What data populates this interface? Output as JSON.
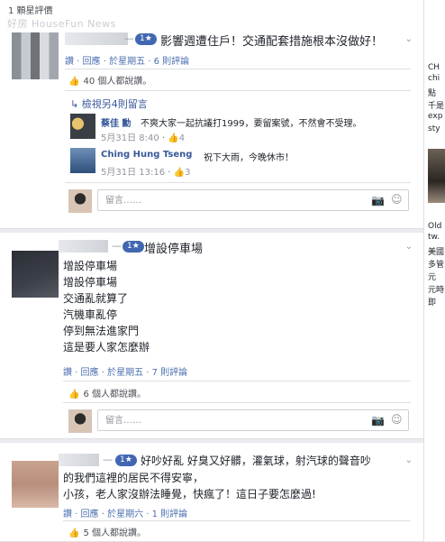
{
  "rating_label": "1 顆星評價",
  "watermark": "好房 HouseFun News",
  "comments": [
    {
      "title": "影響週遭住戶！交通配套措施根本沒做好！",
      "dash": "—",
      "badge": "1★",
      "meta": {
        "like": "讚",
        "reply": "回應",
        "date": "於星期五",
        "edit": "6 則評論"
      },
      "likes": "40 個人都說讚。",
      "more_replies": "檢視另4則留言",
      "replies": [
        {
          "name": "蔡佳 勳",
          "text": "不爽大家一起抗議打1999，要留案號，不然會不受理。",
          "date": "5月31日 8:40",
          "likes": "4"
        },
        {
          "name": "Ching Hung Tseng",
          "text": "祝下大雨，今晚休市！",
          "date": "5月31日 13:16",
          "likes": "3"
        }
      ],
      "input_placeholder": "留言……"
    },
    {
      "title": "增設停車場",
      "dash": "—",
      "badge": "1★",
      "body": [
        "增設停車場",
        "增設停車場",
        "交通亂就算了",
        "汽機車亂停",
        "停到無法進家門",
        "這是要人家怎麼辦"
      ],
      "meta": {
        "like": "讚",
        "reply": "回應",
        "date": "於星期五",
        "edit": "7 則評論"
      },
      "likes": "6 個人都說讚。",
      "input_placeholder": "留言……"
    },
    {
      "title": "好吵好亂 好臭又好髒，灌氣球，射汽球的聲音吵",
      "dash": "—",
      "badge": "1★",
      "body": [
        "的我們這裡的居民不得安寧，",
        "小孩，老人家沒辦法睡覺，快瘋了！這日子要怎麼過!"
      ],
      "meta": {
        "like": "讚",
        "reply": "回應",
        "date": "於星期六",
        "edit": "1 則評論"
      },
      "likes": "5 個人都說讚。"
    }
  ],
  "right_column": [
    "CH",
    "chi",
    "點",
    "千是",
    "exp",
    "sty",
    "Old",
    "tw.",
    "美國",
    "多管",
    "元",
    "元時",
    "即"
  ],
  "icons": {
    "thumb": "thumbs-up-icon",
    "reply": "reply-arrow-icon",
    "camera": "camera-icon",
    "smile": "emoji-icon",
    "chevron": "chevron-down-icon"
  }
}
